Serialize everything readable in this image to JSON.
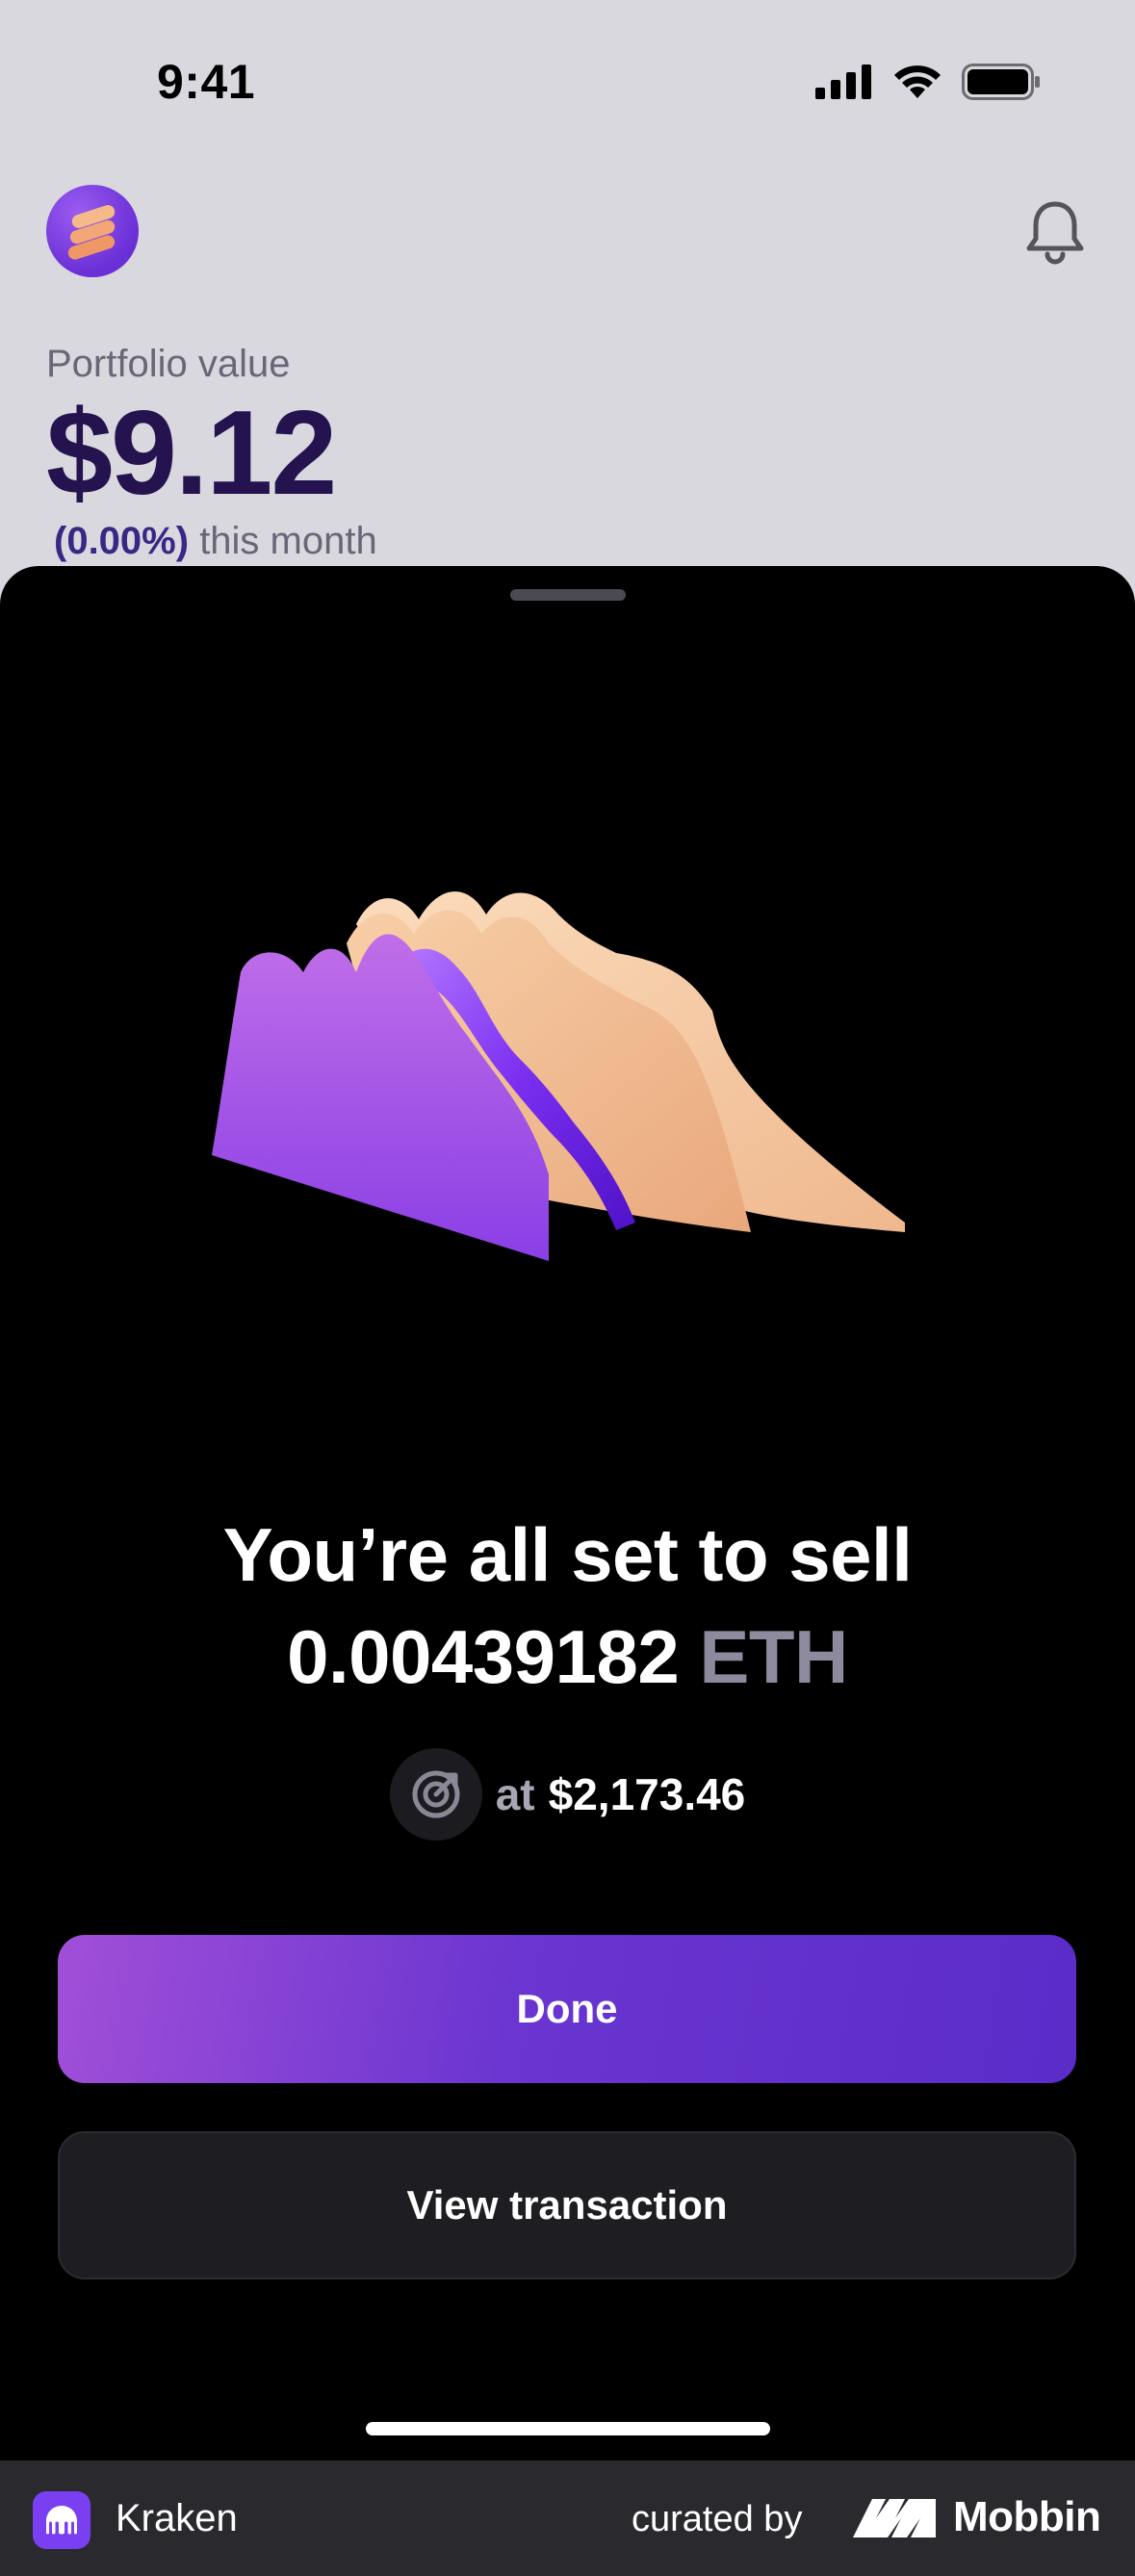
{
  "status_bar": {
    "time": "9:41",
    "icons": [
      "cellular-signal-icon",
      "wifi-icon",
      "battery-icon"
    ]
  },
  "header": {
    "avatar_icon": "stacked-coins-avatar-icon",
    "notifications_icon": "bell-icon",
    "portfolio_label": "Portfolio value",
    "portfolio_value": "$9.12",
    "change_percent": "(0.00%)",
    "change_period": "this month"
  },
  "sheet": {
    "illustration": "3d-chart-waves-illustration",
    "headline_line1": "You’re all set to sell",
    "amount": "0.00439182",
    "asset": "ETH",
    "price_icon": "limit-target-icon",
    "price_prefix": "at",
    "price_value": "$2,173.46",
    "done_label": "Done",
    "view_transaction_label": "View transaction"
  },
  "footer": {
    "app_name": "Kraken",
    "curated_by": "curated by",
    "brand": "Mobbin"
  },
  "colors": {
    "accent_purple": "#6a35d0",
    "portfolio_value": "#25134f",
    "sheet_bg": "#000000",
    "page_bg": "#d9d8de"
  }
}
